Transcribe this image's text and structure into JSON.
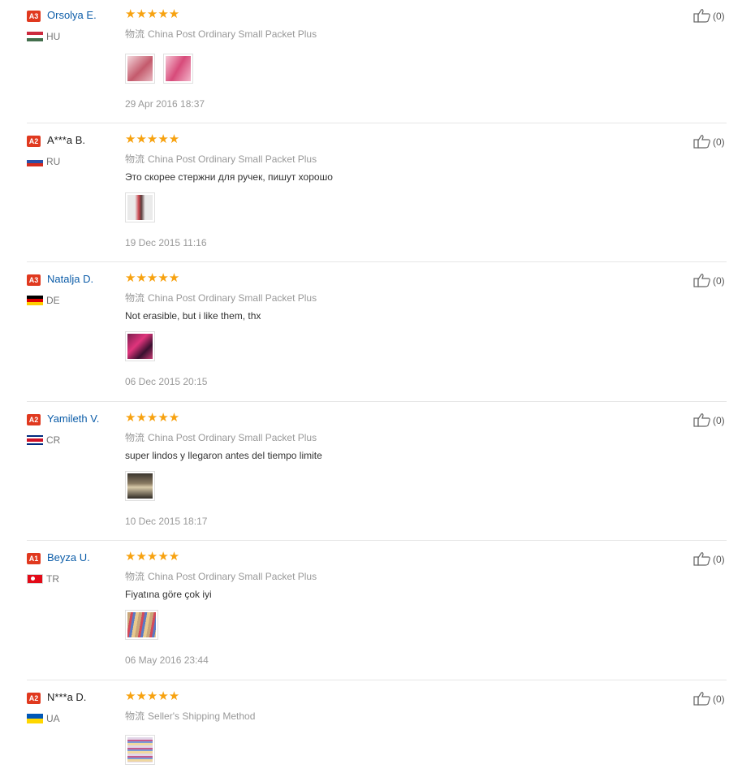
{
  "reviews": [
    {
      "level": "A3",
      "level_color": "#e0391f",
      "name": "Orsolya E.",
      "name_color": "#0b5ca8",
      "country": "HU",
      "stars": "★★★★★",
      "ship_label": "物流",
      "shipping": "China Post Ordinary Small Packet Plus",
      "comment": "",
      "photos": [
        "photo-icon",
        "photo-icon"
      ],
      "date": "29 Apr 2016 18:37",
      "likes": "(0)"
    },
    {
      "level": "A2",
      "level_color": "#e0391f",
      "name": "A***a B.",
      "name_color": "#222222",
      "country": "RU",
      "stars": "★★★★★",
      "ship_label": "物流",
      "shipping": "China Post Ordinary Small Packet Plus",
      "comment": "Это скорее стержни для ручек, пишут хорошо",
      "photos": [
        "photo-icon"
      ],
      "date": "19 Dec 2015 11:16",
      "likes": "(0)"
    },
    {
      "level": "A3",
      "level_color": "#e0391f",
      "name": "Natalja D.",
      "name_color": "#0b5ca8",
      "country": "DE",
      "stars": "★★★★★",
      "ship_label": "物流",
      "shipping": "China Post Ordinary Small Packet Plus",
      "comment": "Not erasible, but i like them, thx",
      "photos": [
        "photo-icon"
      ],
      "date": "06 Dec 2015 20:15",
      "likes": "(0)"
    },
    {
      "level": "A2",
      "level_color": "#e0391f",
      "name": "Yamileth V.",
      "name_color": "#0b5ca8",
      "country": "CR",
      "stars": "★★★★★",
      "ship_label": "物流",
      "shipping": "China Post Ordinary Small Packet Plus",
      "comment": "super lindos y llegaron antes del tiempo limite",
      "photos": [
        "photo-icon"
      ],
      "date": "10 Dec 2015 18:17",
      "likes": "(0)"
    },
    {
      "level": "A1",
      "level_color": "#e0391f",
      "name": "Beyza U.",
      "name_color": "#0b5ca8",
      "country": "TR",
      "stars": "★★★★★",
      "ship_label": "物流",
      "shipping": "China Post Ordinary Small Packet Plus",
      "comment": "Fiyatına göre çok iyi",
      "photos": [
        "photo-icon"
      ],
      "date": "06 May 2016 23:44",
      "likes": "(0)"
    },
    {
      "level": "A2",
      "level_color": "#e0391f",
      "name": "N***a D.",
      "name_color": "#222222",
      "country": "UA",
      "stars": "★★★★★",
      "ship_label": "物流",
      "shipping": "Seller's Shipping Method",
      "comment": "",
      "photos": [
        "photo-icon"
      ],
      "date": "",
      "likes": "(0)"
    }
  ],
  "colors": {
    "star": "#f7a210",
    "link": "#0b5ca8",
    "muted": "#999999"
  }
}
